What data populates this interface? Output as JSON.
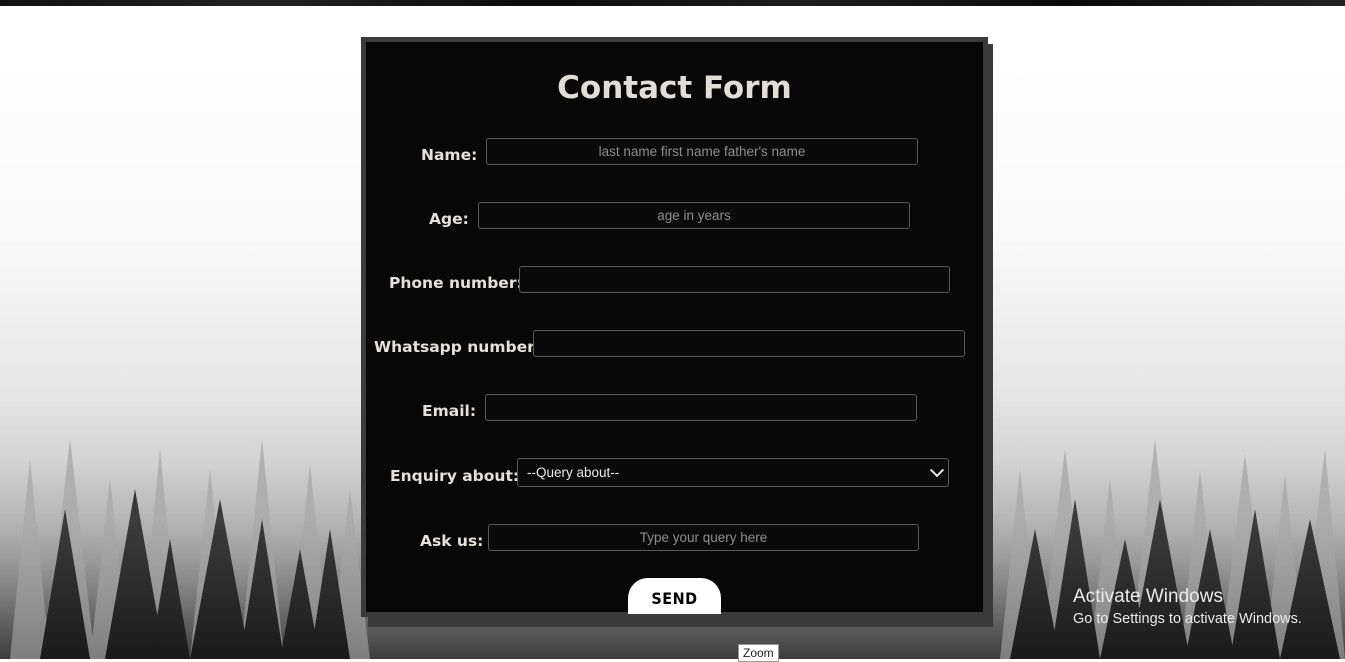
{
  "form": {
    "title": "Contact Form",
    "name": {
      "label": "Name:",
      "placeholder": "last name first name father's name",
      "value": ""
    },
    "age": {
      "label": "Age:",
      "placeholder": "age in years",
      "value": ""
    },
    "phone": {
      "label": "Phone number:",
      "placeholder": "",
      "value": ""
    },
    "whatsapp": {
      "label": "Whatsapp number:",
      "placeholder": "",
      "value": ""
    },
    "email": {
      "label": "Email:",
      "placeholder": "",
      "value": ""
    },
    "enquiry": {
      "label": "Enquiry about:",
      "selected": "--Query about--"
    },
    "ask": {
      "label": "Ask us:",
      "placeholder": "Type your query here",
      "value": ""
    },
    "send_label": "SEND"
  },
  "watermark": {
    "line1": "Activate Windows",
    "line2": "Go to Settings to activate Windows."
  },
  "tooltip": {
    "text": "Zoom"
  },
  "colors": {
    "card_bg": "#070707",
    "card_border": "#3b3b3b",
    "label_text": "#e6e0da",
    "button_bg": "#ffffff"
  }
}
